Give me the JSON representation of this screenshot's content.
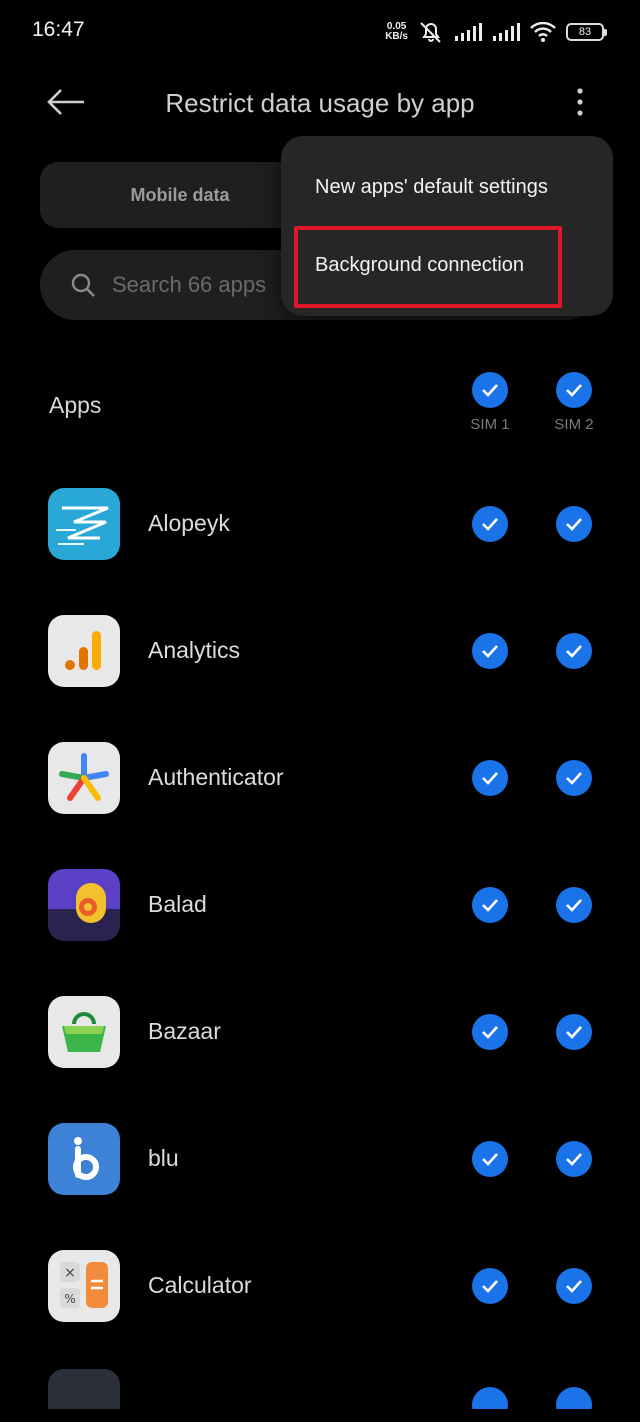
{
  "status_bar": {
    "time": "16:47",
    "net_speed_value": "0.05",
    "net_speed_unit": "KB/s",
    "battery": "83",
    "icons": [
      "mute-icon",
      "signal-icon",
      "signal-icon",
      "wifi-icon",
      "battery-icon"
    ]
  },
  "header": {
    "title": "Restrict data usage by app",
    "back_icon": "arrow-left-icon",
    "more_icon": "more-vertical-icon"
  },
  "tabs": [
    {
      "label": "Mobile data"
    },
    {
      "label": ""
    }
  ],
  "search": {
    "placeholder": "Search 66 apps",
    "value": "",
    "icon": "search-icon"
  },
  "list": {
    "title": "Apps",
    "sim1_label": "SIM 1",
    "sim2_label": "SIM 2",
    "sim1_checked": true,
    "sim2_checked": true
  },
  "apps": [
    {
      "name": "Alopeyk",
      "icon": "alopeyk-icon",
      "sim1": true,
      "sim2": true
    },
    {
      "name": "Analytics",
      "icon": "analytics-icon",
      "sim1": true,
      "sim2": true
    },
    {
      "name": "Authenticator",
      "icon": "authenticator-icon",
      "sim1": true,
      "sim2": true
    },
    {
      "name": "Balad",
      "icon": "balad-icon",
      "sim1": true,
      "sim2": true
    },
    {
      "name": "Bazaar",
      "icon": "bazaar-icon",
      "sim1": true,
      "sim2": true
    },
    {
      "name": "blu",
      "icon": "blu-icon",
      "sim1": true,
      "sim2": true
    },
    {
      "name": "Calculator",
      "icon": "calculator-icon",
      "sim1": true,
      "sim2": true
    }
  ],
  "menu": {
    "items": [
      {
        "label": "New apps' default settings"
      },
      {
        "label": "Background connection",
        "highlighted": true
      }
    ]
  },
  "colors": {
    "background": "#000000",
    "surface": "#1f1f1f",
    "menu_surface": "#262626",
    "accent": "#1a73e8",
    "highlight": "#e0162b"
  }
}
